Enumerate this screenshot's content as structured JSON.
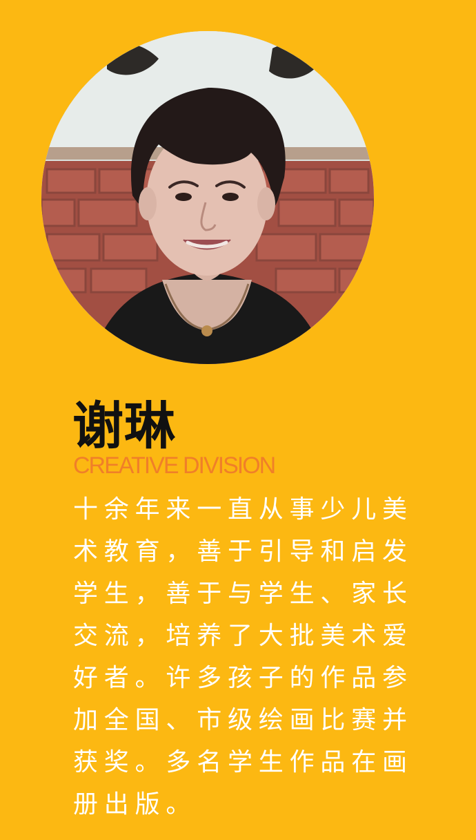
{
  "profile": {
    "photo_alt": "portrait-photo",
    "name": "谢琳",
    "division": "CREATIVE DIVISION",
    "bio_lines": [
      "十余年来一直从事少儿美",
      "术教育，善于引导和启发",
      "学生，善于与学生、家长",
      "交流，培养了大批美术爱",
      "好者。许多孩子的作品参",
      "加全国、市级绘画比赛并",
      "获奖。多名学生作品在画",
      "册出版。"
    ]
  },
  "colors": {
    "background": "#FCB812",
    "name": "#111111",
    "division": "#F07F29",
    "bio": "#FFFFFF"
  }
}
